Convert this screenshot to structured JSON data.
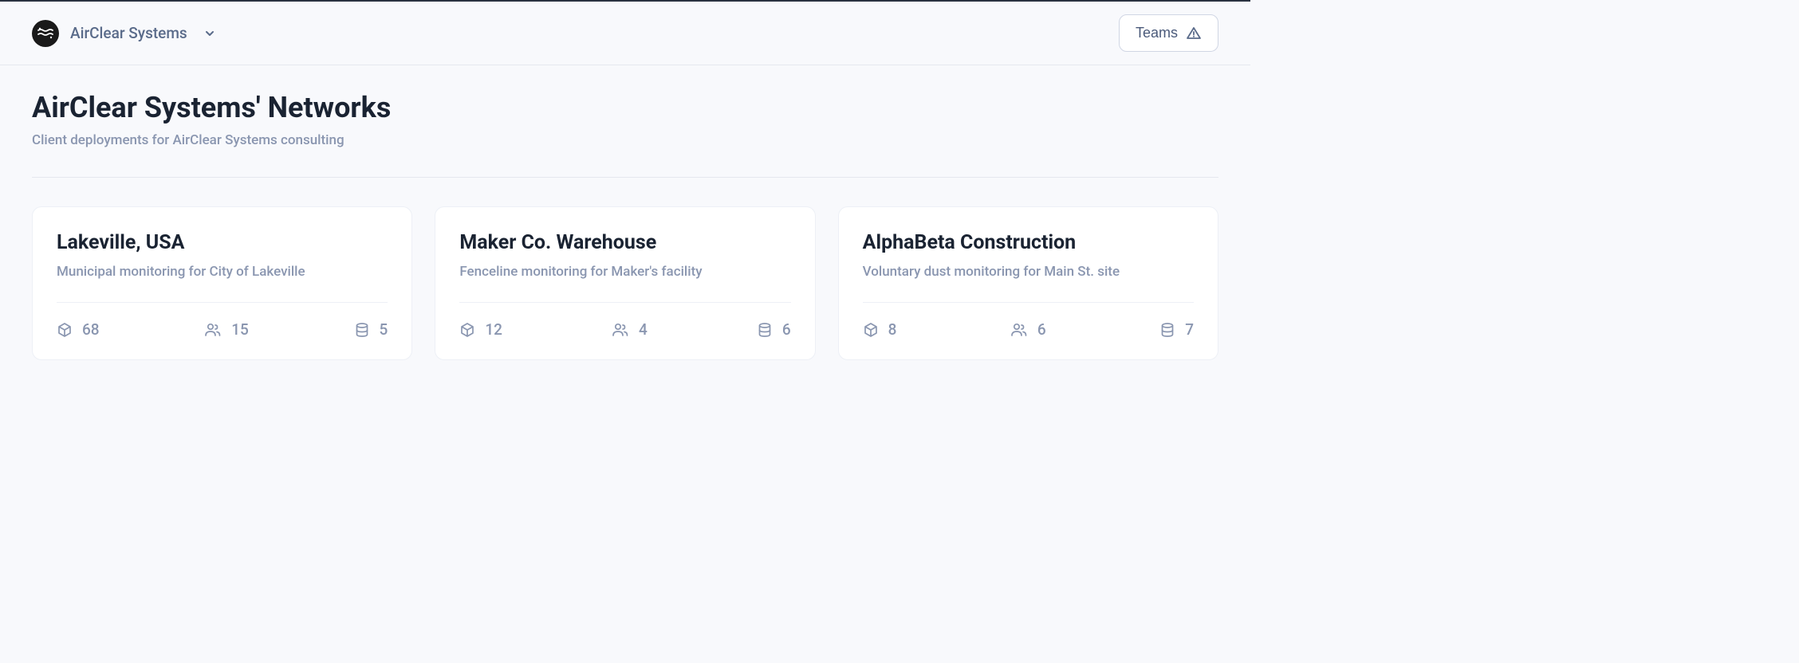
{
  "header": {
    "org_name": "AirClear Systems",
    "teams_label": "Teams"
  },
  "page": {
    "title": "AirClear Systems' Networks",
    "subtitle": "Client deployments for AirClear Systems consulting"
  },
  "cards": [
    {
      "title": "Lakeville, USA",
      "description": "Municipal monitoring for City of Lakeville",
      "devices": "68",
      "users": "15",
      "databases": "5"
    },
    {
      "title": "Maker Co. Warehouse",
      "description": "Fenceline monitoring for Maker's facility",
      "devices": "12",
      "users": "4",
      "databases": "6"
    },
    {
      "title": "AlphaBeta Construction",
      "description": "Voluntary dust monitoring for Main St. site",
      "devices": "8",
      "users": "6",
      "databases": "7"
    }
  ]
}
